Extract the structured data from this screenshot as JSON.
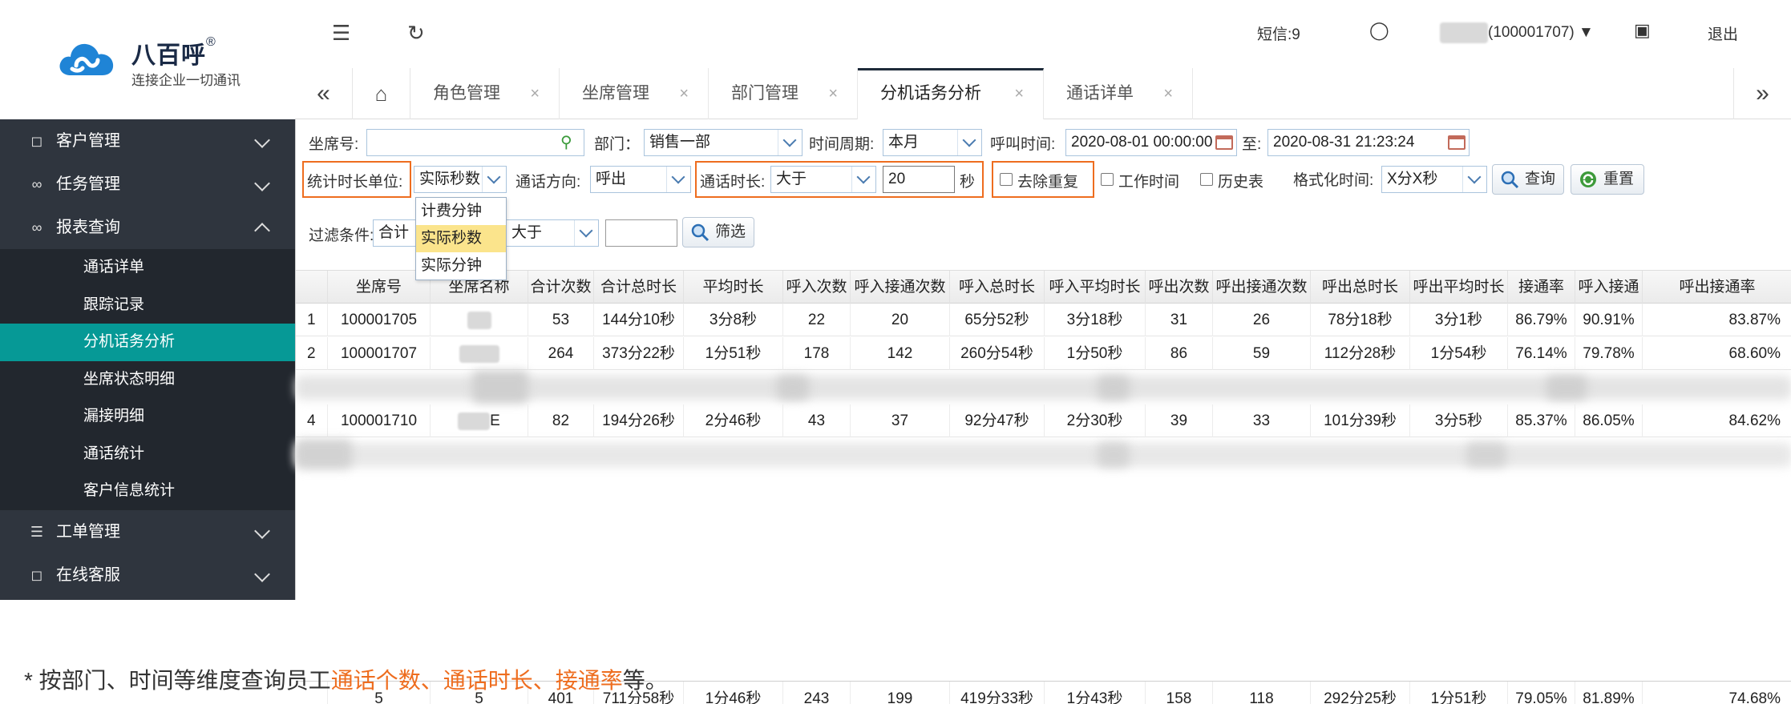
{
  "brand": {
    "name": "八百呼",
    "reg": "®",
    "tagline": "连接企业一切通讯"
  },
  "header": {
    "sms_label": "短信:9",
    "user_id": "(100001707)",
    "logout_label": "退出"
  },
  "sidebar": {
    "groups": [
      {
        "label": "客户管理",
        "icon": "user-icon"
      },
      {
        "label": "任务管理",
        "icon": "link-icon"
      },
      {
        "label": "报表查询",
        "icon": "link-icon",
        "expanded": true
      },
      {
        "label": "工单管理",
        "icon": "list-icon"
      },
      {
        "label": "在线客服",
        "icon": "user-icon"
      }
    ],
    "report_items": [
      "通话详单",
      "跟踪记录",
      "分机话务分析",
      "坐席状态明细",
      "漏接明细",
      "通话统计",
      "客户信息统计"
    ],
    "active_item": "分机话务分析"
  },
  "tabs": [
    "角色管理",
    "坐席管理",
    "部门管理",
    "分机话务分析",
    "通话详单"
  ],
  "active_tab": "分机话务分析",
  "filters": {
    "seat_label": "坐席号:",
    "seat_value": "",
    "dept_label": "部门：",
    "dept_value": "销售一部",
    "period_label": "时间周期:",
    "period_value": "本月",
    "call_time_label": "呼叫时间:",
    "call_time_start": "2020-08-01 00:00:00",
    "to_label": "至:",
    "call_time_end": "2020-08-31 21:23:24",
    "unit_label": "统计时长单位:",
    "unit_value": "实际秒数",
    "direction_label": "通话方向:",
    "direction_value": "呼出",
    "duration_label": "通话时长:",
    "duration_op": "大于",
    "duration_value": "20",
    "duration_unit": "秒",
    "dedupe_label": "去除重复",
    "worktime_label": "工作时间",
    "history_label": "历史表",
    "format_label": "格式化时间:",
    "format_value": "X分X秒",
    "query_button": "查询",
    "reset_button": "重置",
    "filter_label": "过滤条件:",
    "filter_field": "合计",
    "filter_op": "大于",
    "filter_value": "",
    "filter_button": "筛选",
    "unit_options": [
      "计费分钟",
      "实际秒数",
      "实际分钟"
    ]
  },
  "table": {
    "columns": [
      "坐席号",
      "坐席名称",
      "合计次数",
      "合计总时长",
      "平均时长",
      "呼入次数",
      "呼入接通次数",
      "呼入总时长",
      "呼入平均时长",
      "呼出次数",
      "呼出接通次数",
      "呼出总时长",
      "呼出平均时长",
      "接通率",
      "呼入接通",
      "呼出接通率"
    ],
    "rows": [
      {
        "num": "1",
        "seat": "100001705",
        "name": "",
        "total": "53",
        "total_dur": "144分10秒",
        "avg": "3分8秒",
        "in": "22",
        "in_conn": "20",
        "in_dur": "65分52秒",
        "in_avg": "3分18秒",
        "out": "31",
        "out_conn": "26",
        "out_dur": "78分18秒",
        "out_avg": "3分1秒",
        "rate": "86.79%",
        "in_rate": "90.91%",
        "out_rate": "83.87%"
      },
      {
        "num": "2",
        "seat": "100001707",
        "name": "",
        "total": "264",
        "total_dur": "373分22秒",
        "avg": "1分51秒",
        "in": "178",
        "in_conn": "142",
        "in_dur": "260分54秒",
        "in_avg": "1分50秒",
        "out": "86",
        "out_conn": "59",
        "out_dur": "112分28秒",
        "out_avg": "1分54秒",
        "rate": "76.14%",
        "in_rate": "79.78%",
        "out_rate": "68.60%"
      },
      {
        "num": "4",
        "seat": "100001710",
        "name": "E",
        "total": "82",
        "total_dur": "194分26秒",
        "avg": "2分46秒",
        "in": "43",
        "in_conn": "37",
        "in_dur": "92分47秒",
        "in_avg": "2分30秒",
        "out": "39",
        "out_conn": "33",
        "out_dur": "101分39秒",
        "out_avg": "3分5秒",
        "rate": "85.37%",
        "in_rate": "86.05%",
        "out_rate": "84.62%"
      }
    ],
    "footer": {
      "seat": "5",
      "name": "5",
      "total": "401",
      "total_dur": "711分58秒",
      "avg": "1分46秒",
      "in": "243",
      "in_conn": "199",
      "in_dur": "419分33秒",
      "in_avg": "1分43秒",
      "out": "158",
      "out_conn": "118",
      "out_dur": "292分25秒",
      "out_avg": "1分51秒",
      "rate": "79.05%",
      "in_rate": "81.89%",
      "out_rate": "74.68%"
    }
  },
  "caption": {
    "prefix": "* 按部门、时间等维度查询员工",
    "highlight": "通话个数、通话时长、接通率",
    "suffix": "等。"
  },
  "colors": {
    "sidebar_bg": "#2f353e",
    "active_item": "#069996",
    "highlight": "#ee6d1f"
  }
}
